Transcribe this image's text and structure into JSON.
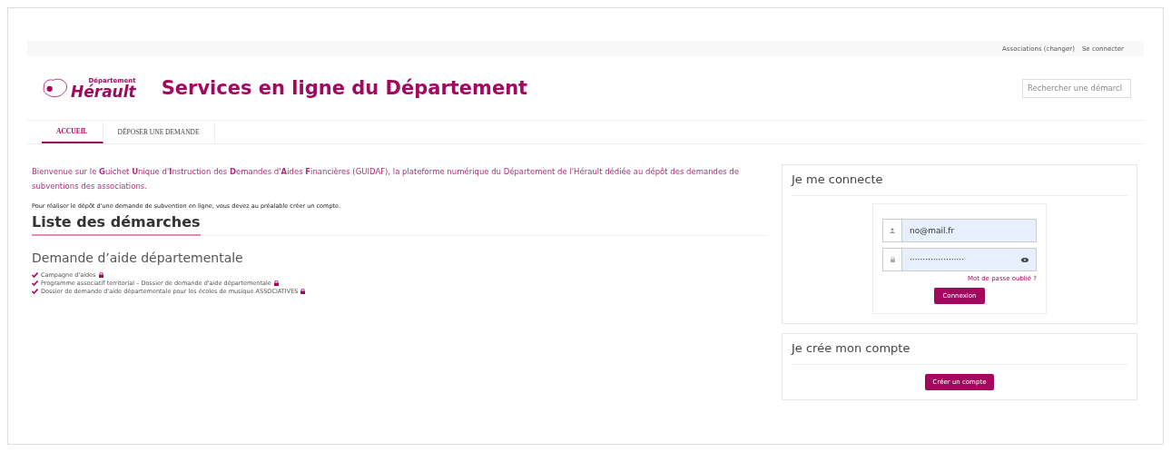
{
  "top_links": [
    "Associations (changer)",
    "Se connecter"
  ],
  "logo": {
    "small": "Département",
    "big": "Hérault"
  },
  "title": "Services en ligne du Département",
  "search": {
    "placeholder": "Rechercher une démarcl"
  },
  "tabs": [
    {
      "label": "ACCUEIL",
      "selected": true
    },
    {
      "label": "DÉPOSER UNE DEMANDE",
      "selected": false
    }
  ],
  "intro": "Bienvenue sur le **G**uichet **U**nique d'**I**nstruction des **D**emandes d'**A**ides **F**inancières (GUIDAF), la plateforme numérique du Département de l'Hérault dédiée au dépôt des demandes de subventions des associations.",
  "notice": "Pour réaliser le dépôt d'une demande de subvention en ligne, vous devez au préalable créer un compte.",
  "list_title": "Liste des démarches",
  "section_title": "Demande d’aide départementale",
  "procedures": [
    {
      "label": "Campagne d'aides",
      "locked": true
    },
    {
      "label": "Programme associatif territorial – Dossier de demande d'aide départementale",
      "locked": true
    },
    {
      "label": "Dossier de demande d'aide départementale pour les écoles de musique ASSOCIATIVES",
      "locked": true
    }
  ],
  "login": {
    "title": "Je me connecte",
    "email": "no@mail.fr",
    "password": "·····················",
    "forgot": "Mot de passe oublié ?",
    "button": "Connexion"
  },
  "signup": {
    "title": "Je crée mon compte",
    "button": "Créer un compte"
  }
}
